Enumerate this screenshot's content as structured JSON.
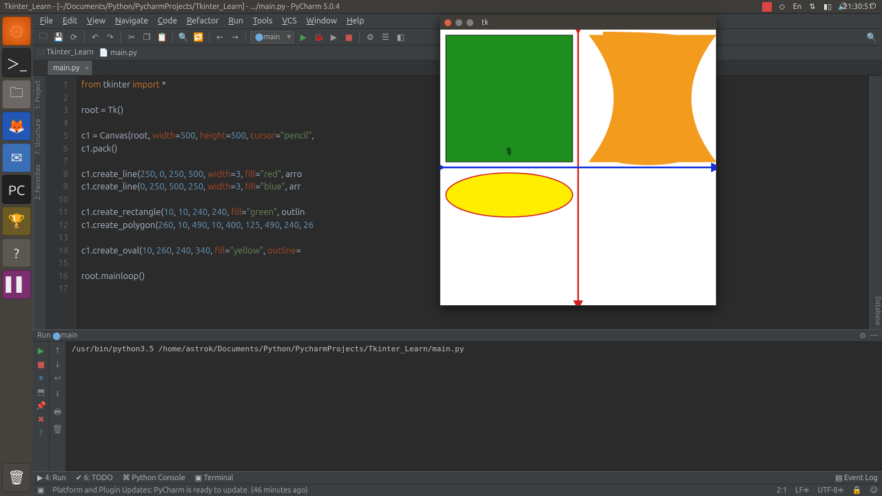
{
  "os": {
    "title": "Tkinter_Learn - [~/Documents/Python/PycharmProjects/Tkinter_Learn] - .../main.py - PyCharm 5.0.4",
    "lang": "En",
    "time": "21:30:51"
  },
  "menubar": [
    "File",
    "Edit",
    "View",
    "Navigate",
    "Code",
    "Refactor",
    "Run",
    "Tools",
    "VCS",
    "Window",
    "Help"
  ],
  "run_config": "main",
  "crumbs": {
    "project": "Tkinter_Learn",
    "file": "main.py"
  },
  "tab": "main.py",
  "sidetabs_left": [
    "1: Project",
    "7: Structure",
    "2: Favorites"
  ],
  "sidetabs_right": [
    "Database"
  ],
  "code": {
    "lines": 17,
    "l1_a": "from",
    "l1_b": " tkinter ",
    "l1_c": "import",
    "l1_d": " *",
    "l3": "root = Tk()",
    "l5_a": "c1 = Canvas(root, ",
    "l5_w": "width",
    "l5_e": "=",
    "l5_wn": "500",
    "l5_c": ", ",
    "l5_h": "height",
    "l5_hn": "500",
    "l5_cur": "cursor",
    "l5_curv": "\"pencil\"",
    "l5_end": ",",
    "l6": "c1.pack()",
    "l8_a": "c1.create_line(",
    "l8_n": "250, 0, 250, 500",
    "l8_b": ", ",
    "l8_w": "width",
    "l8_e": "=",
    "l8_wn": "3",
    "l8_c": ", ",
    "l8_f": "fill",
    "l8_fv": "\"red\"",
    "l8_d": ", arro",
    "l9_a": "c1.create_line(",
    "l9_n": "0, 250, 500, 250",
    "l9_b": ", ",
    "l9_w": "width",
    "l9_e": "=",
    "l9_wn": "3",
    "l9_c": ", ",
    "l9_f": "fill",
    "l9_fv": "\"blue\"",
    "l9_d": ", arr",
    "l11_a": "c1.create_rectangle(",
    "l11_n": "10, 10, 240, 240",
    "l11_b": ", ",
    "l11_f": "fill",
    "l11_e": "=",
    "l11_fv": "\"green\"",
    "l11_c": ", outlin",
    "l12_a": "c1.create_polygon(",
    "l12_n": "260, 10, 490, 10, 400, 125, 490, 240, 26",
    "l14_a": "c1.create_oval(",
    "l14_n": "10, 260, 240, 340",
    "l14_b": ", ",
    "l14_f": "fill",
    "l14_e": "=",
    "l14_fv": "\"yellow\"",
    "l14_c": ", ",
    "l14_o": "outline",
    "l14_oe": "=",
    "l16": "root.mainloop()"
  },
  "run": {
    "label": "Run",
    "config": "main",
    "output": "/usr/bin/python3.5 /home/astrok/Documents/Python/PycharmProjects/Tkinter_Learn/main.py"
  },
  "bottom": {
    "run": "4: Run",
    "todo": "6: TODO",
    "pyconsole": "Python Console",
    "terminal": "Terminal",
    "eventlog": "Event Log"
  },
  "status": {
    "msg": "Platform and Plugin Updates: PyCharm is ready to update. (46 minutes ago)",
    "pos": "2:1",
    "lf": "LF≑",
    "enc": "UTF-8≑",
    "lock": "🔒"
  },
  "tk": {
    "title": "tk"
  }
}
